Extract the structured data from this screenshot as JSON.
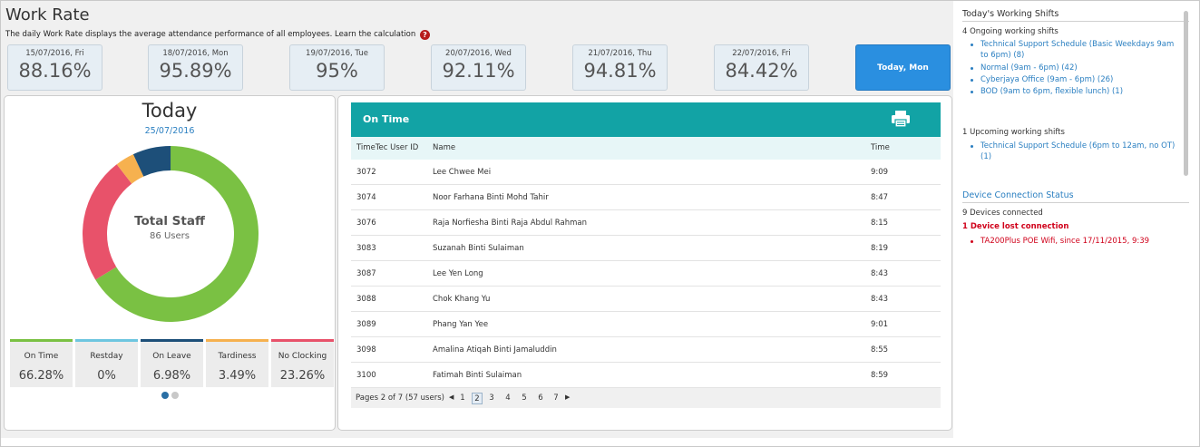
{
  "header": {
    "title": "Work Rate",
    "subtitle": "The daily Work Rate displays the average attendance performance of all employees. Learn the calculation",
    "help_icon": "?"
  },
  "day_cards": [
    {
      "date": "15/07/2016, Fri",
      "rate": "88.16%"
    },
    {
      "date": "18/07/2016, Mon",
      "rate": "95.89%"
    },
    {
      "date": "19/07/2016, Tue",
      "rate": "95%"
    },
    {
      "date": "20/07/2016, Wed",
      "rate": "92.11%"
    },
    {
      "date": "21/07/2016, Thu",
      "rate": "94.81%"
    },
    {
      "date": "22/07/2016, Fri",
      "rate": "84.42%"
    }
  ],
  "today_button": "Today, Mon",
  "today": {
    "title": "Today",
    "date": "25/07/2016",
    "donut_title": "Total Staff",
    "donut_subtitle": "86 Users",
    "stats": [
      {
        "label": "On Time",
        "value": "66.28%",
        "color": "#7ac143"
      },
      {
        "label": "Restday",
        "value": "0%",
        "color": "#6ec6e0"
      },
      {
        "label": "On Leave",
        "value": "6.98%",
        "color": "#1d4f79"
      },
      {
        "label": "Tardiness",
        "value": "3.49%",
        "color": "#f6b14f"
      },
      {
        "label": "No Clocking",
        "value": "23.26%",
        "color": "#e8526a"
      }
    ]
  },
  "ontime": {
    "title": "On Time",
    "print_icon": "printer-icon",
    "columns": [
      "TimeTec User ID",
      "Name",
      "Time"
    ],
    "rows": [
      [
        "3072",
        "Lee Chwee Mei",
        "9:09"
      ],
      [
        "3074",
        "Noor Farhana Binti Mohd Tahir",
        "8:47"
      ],
      [
        "3076",
        "Raja Norfiesha Binti Raja Abdul Rahman",
        "8:15"
      ],
      [
        "3083",
        "Suzanah Binti Sulaiman",
        "8:19"
      ],
      [
        "3087",
        "Lee Yen Long",
        "8:43"
      ],
      [
        "3088",
        "Chok Khang Yu",
        "8:43"
      ],
      [
        "3089",
        "Phang Yan Yee",
        "9:01"
      ],
      [
        "3098",
        "Amalina Atiqah Binti Jamaluddin",
        "8:55"
      ],
      [
        "3100",
        "Fatimah Binti Sulaiman",
        "8:59"
      ]
    ],
    "pager_info": "Pages 2 of 7 (57 users)",
    "pages": [
      "1",
      "2",
      "3",
      "4",
      "5",
      "6",
      "7"
    ],
    "active_page": "2"
  },
  "right": {
    "shifts_heading": "Today's Working Shifts",
    "ongoing_label": "4 Ongoing working shifts",
    "ongoing": [
      "Technical Support Schedule (Basic Weekdays 9am to 6pm) (8)",
      "Normal (9am - 6pm) (42)",
      "Cyberjaya Office (9am - 6pm) (26)",
      "BOD (9am to 6pm, flexible lunch) (1)"
    ],
    "upcoming_label": "1 Upcoming working shifts",
    "upcoming": [
      "Technical Support Schedule (6pm to 12am, no OT) (1)"
    ],
    "device_heading": "Device Connection Status",
    "devices_connected": "9 Devices connected",
    "lost_label": "1 Device lost connection",
    "lost_devices": [
      "TA200Plus POE Wifi, since 17/11/2015, 9:39"
    ]
  }
}
